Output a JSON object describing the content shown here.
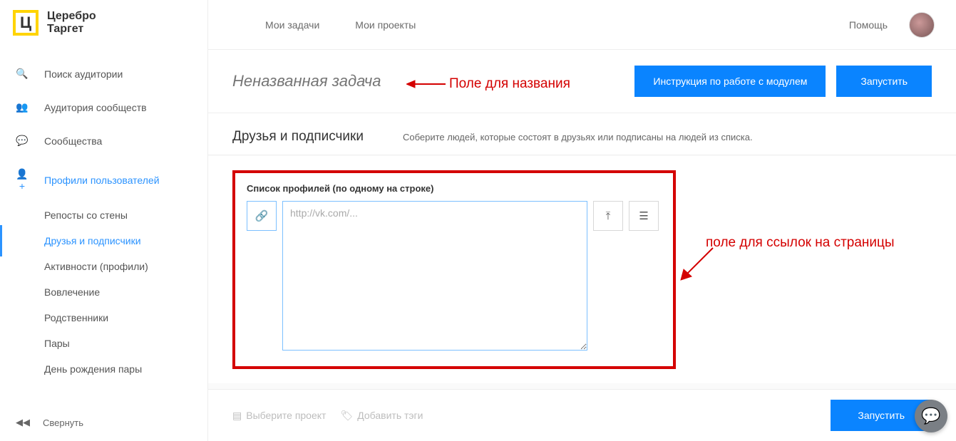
{
  "brand": {
    "logo_letter": "Ц",
    "name_line1": "Церебро",
    "name_line2": "Таргет"
  },
  "nav": {
    "items": [
      {
        "icon": "🔍",
        "label": "Поиск аудитории"
      },
      {
        "icon": "👥",
        "label": "Аудитория сообществ"
      },
      {
        "icon": "💬",
        "label": "Сообщества"
      },
      {
        "icon": "👤+",
        "label": "Профили пользователей"
      }
    ],
    "sub": [
      {
        "label": "Репосты со стены"
      },
      {
        "label": "Друзья и подписчики"
      },
      {
        "label": "Активности (профили)"
      },
      {
        "label": "Вовлечение"
      },
      {
        "label": "Родственники"
      },
      {
        "label": "Пары"
      },
      {
        "label": "День рождения пары"
      }
    ],
    "collapse": {
      "icon": "◀◀",
      "label": "Свернуть"
    }
  },
  "top": {
    "tabs": [
      "Мои задачи",
      "Мои проекты"
    ],
    "help": "Помощь"
  },
  "task": {
    "title_placeholder": "Неназванная задача",
    "btn_instructions": "Инструкция по работе с модулем",
    "btn_run": "Запустить"
  },
  "section": {
    "title": "Друзья и подписчики",
    "desc": "Соберите людей, которые состоят в друзьях или подписаны на людей из списка."
  },
  "form": {
    "field_label": "Список профилей (по одному на строке)",
    "textarea_placeholder": "http://vk.com/..."
  },
  "footer": {
    "select_project": "Выберите проект",
    "add_tags": "Добавить тэги",
    "run": "Запустить"
  },
  "annotations": {
    "title_hint": "Поле для названия",
    "links_hint": "поле для ссылок на страницы"
  }
}
